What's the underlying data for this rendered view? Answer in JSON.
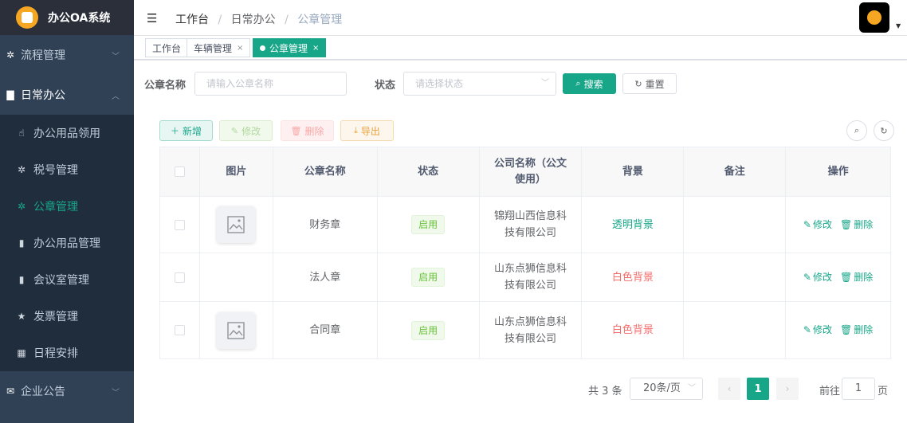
{
  "app": {
    "title": "办公OA系统"
  },
  "sidebar": {
    "top_items": [
      {
        "label": "流程管理",
        "icon": "gear-icon"
      }
    ],
    "open_group": {
      "label": "日常办公",
      "icon": "document-icon"
    },
    "sub_items": [
      {
        "label": "办公用品领用",
        "icon": "hand-icon"
      },
      {
        "label": "税号管理",
        "icon": "gear-icon"
      },
      {
        "label": "公章管理",
        "icon": "gear-icon"
      },
      {
        "label": "办公用品管理",
        "icon": "book-icon"
      },
      {
        "label": "会议室管理",
        "icon": "book-icon"
      },
      {
        "label": "发票管理",
        "icon": "star-icon"
      },
      {
        "label": "日程安排",
        "icon": "grid-icon"
      }
    ],
    "bottom_items": [
      {
        "label": "企业公告",
        "icon": "mail-icon"
      }
    ]
  },
  "header": {
    "breadcrumb": [
      "工作台",
      "日常办公",
      "公章管理"
    ]
  },
  "tags": [
    {
      "label": "工作台"
    },
    {
      "label": "车辆管理",
      "close": "×"
    },
    {
      "label": "公章管理",
      "close": "×"
    }
  ],
  "search": {
    "name_label": "公章名称",
    "name_placeholder": "请输入公章名称",
    "status_label": "状态",
    "status_placeholder": "请选择状态",
    "search_button": "搜索",
    "reset_button": "重置"
  },
  "toolbar": {
    "add": "新增",
    "edit": "修改",
    "delete": "删除",
    "export": "导出"
  },
  "table": {
    "columns": [
      "图片",
      "公章名称",
      "状态",
      "公司名称（公文使用）",
      "背景",
      "备注",
      "操作"
    ],
    "rows": [
      {
        "has_image": true,
        "name": "财务章",
        "status": "启用",
        "company": "锦翔山西信息科技有限公司",
        "background": "透明背景",
        "bg_type": "transparent",
        "remark": ""
      },
      {
        "has_image": false,
        "name": "法人章",
        "status": "启用",
        "company": "山东点狮信息科技有限公司",
        "background": "白色背景",
        "bg_type": "white",
        "remark": ""
      },
      {
        "has_image": true,
        "name": "合同章",
        "status": "启用",
        "company": "山东点狮信息科技有限公司",
        "background": "白色背景",
        "bg_type": "white",
        "remark": ""
      }
    ],
    "op_edit": "修改",
    "op_delete": "删除"
  },
  "pagination": {
    "total_text": "共 3 条",
    "page_size": "20条/页",
    "current_page": "1",
    "goto_label": "前往",
    "goto_value": "1",
    "page_suffix": "页"
  },
  "colors": {
    "accent": "#18a689",
    "sidebar_bg": "#304156",
    "danger": "#f56c6c",
    "success": "#67c23a"
  }
}
